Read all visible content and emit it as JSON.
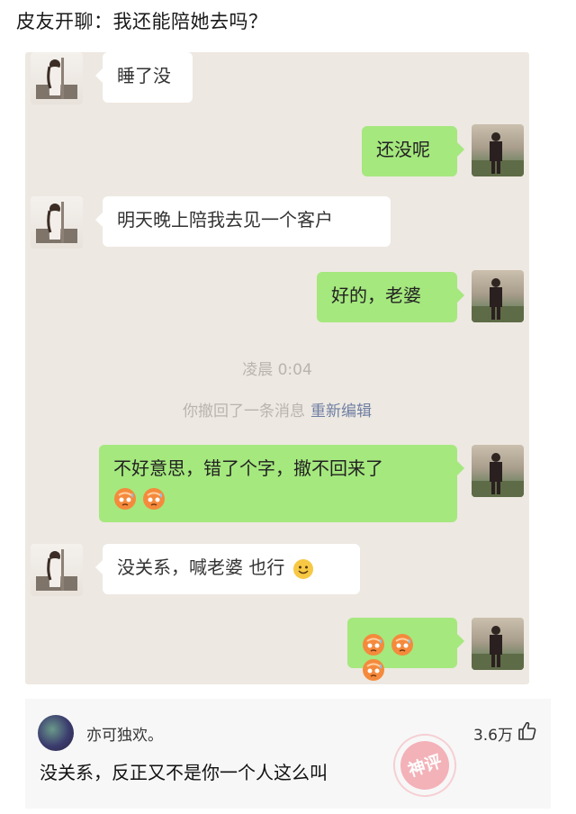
{
  "post": {
    "title": "皮友开聊：我还能陪她去吗？"
  },
  "chat": {
    "messages": [
      {
        "side": "left",
        "text": "睡了没"
      },
      {
        "side": "right",
        "text": "还没呢"
      },
      {
        "side": "left",
        "text": "明天晚上陪我去见一个客户"
      },
      {
        "side": "right",
        "text": "好的，老婆"
      },
      {
        "side": "right",
        "text": "不好意思，错了个字，撤不回来了"
      },
      {
        "side": "left",
        "text": "没关系，喊老婆 也行"
      }
    ],
    "time_label": "凌晨 0:04",
    "recall_notice": "你撤回了一条消息",
    "recall_action": "重新编辑"
  },
  "comment": {
    "user": "亦可独欢。",
    "likes": "3.6万",
    "text": "没关系，反正又不是你一个人这么叫",
    "badge": "神评"
  },
  "icons": {
    "like": "thumbs-up-icon",
    "emoji_sad": "sweat-face-emoji",
    "emoji_smile": "smile-emoji"
  },
  "colors": {
    "chat_bg": "#ede8e1",
    "bubble_sent": "#a5e87e",
    "bubble_received": "#ffffff",
    "recall_edit": "#6f7fa3",
    "stamp": "#f0a4ad"
  }
}
